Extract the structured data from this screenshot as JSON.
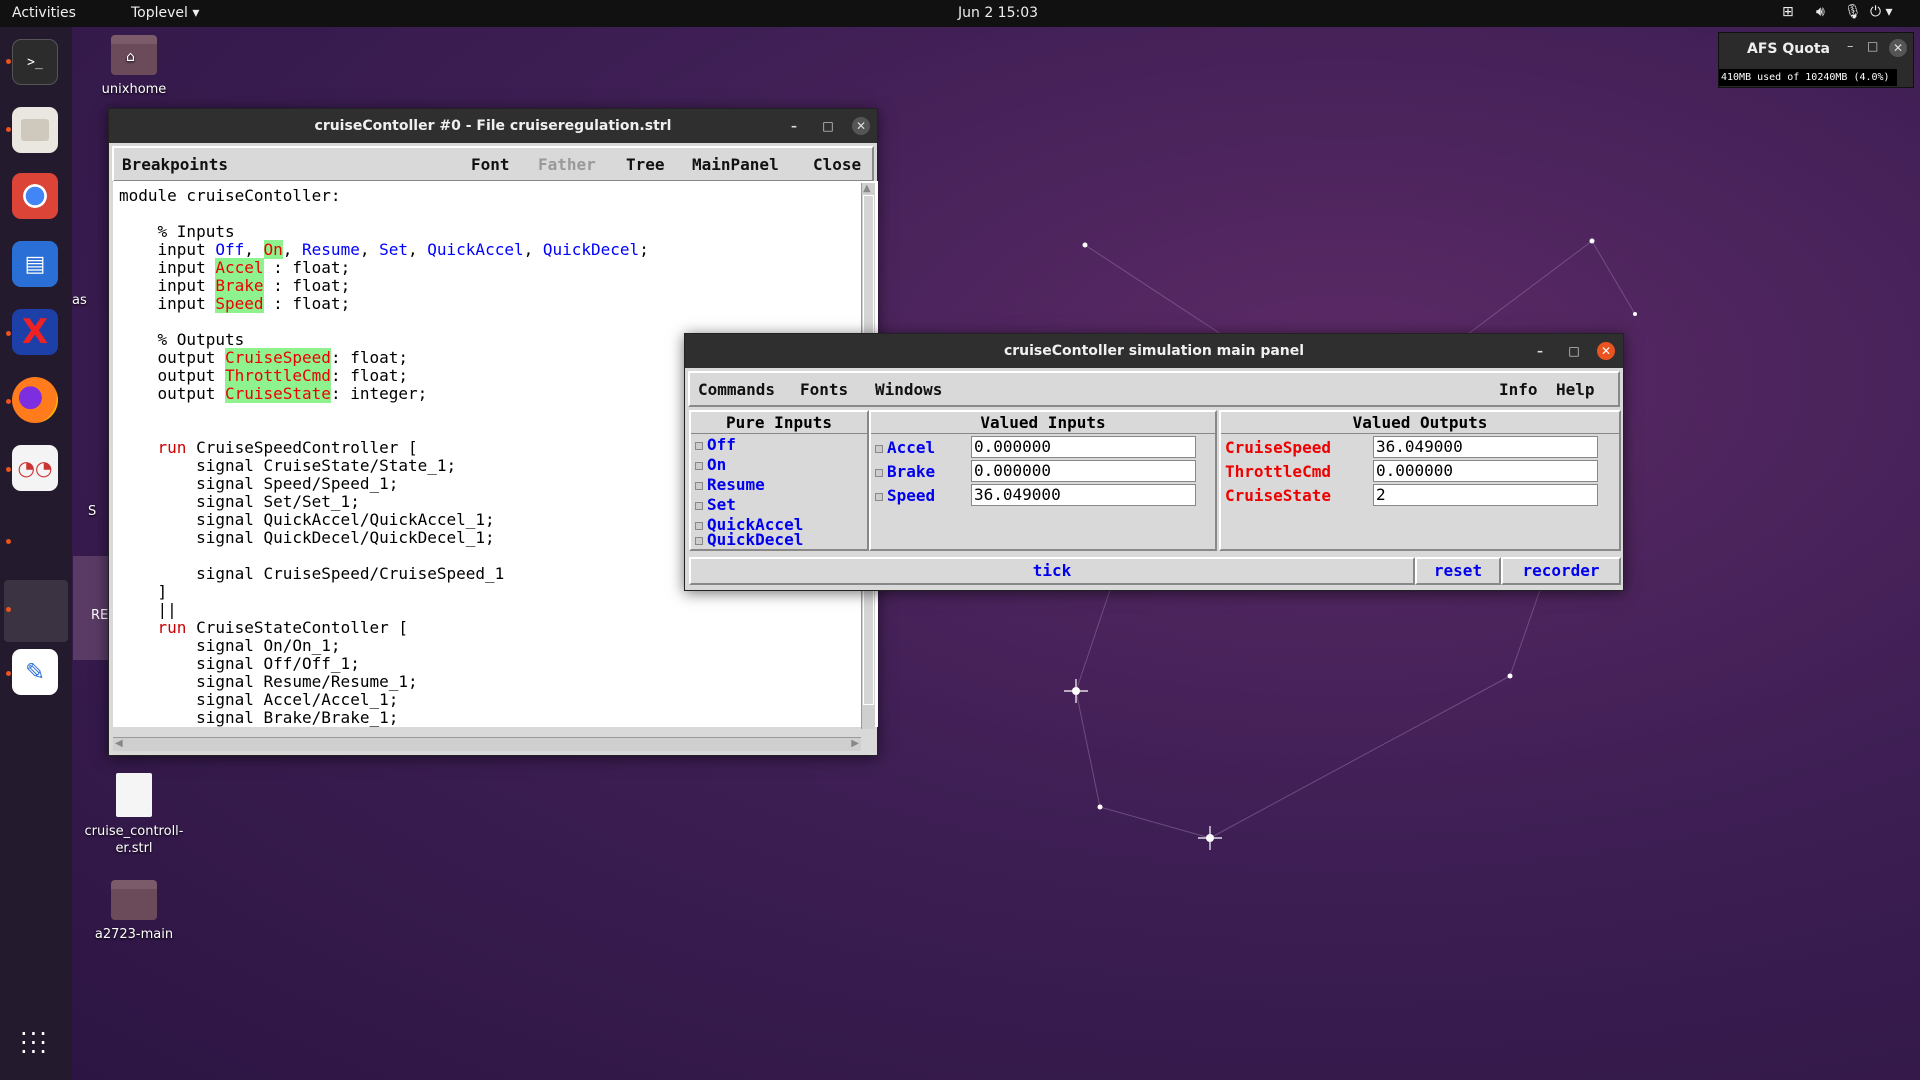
{
  "topbar": {
    "activities": "Activities",
    "app_menu": "Toplevel",
    "clock": "Jun 2  15:03"
  },
  "afs": {
    "title": "AFS Quota",
    "usage": "410MB used of 10240MB (4.0%)"
  },
  "desktop": {
    "items": [
      {
        "label": "unixhome"
      },
      {
        "label": "cruise_controll-er.strl"
      },
      {
        "label": "a2723-main"
      }
    ],
    "partial": [
      "as",
      "S",
      "RE"
    ]
  },
  "source_window": {
    "title": "cruiseContoller  #0 - File cruiseregulation.strl",
    "menu": {
      "breakpoints": "Breakpoints",
      "font": "Font",
      "father": "Father",
      "tree": "Tree",
      "mainpanel": "MainPanel",
      "close": "Close"
    }
  },
  "panel_window": {
    "title": "cruiseContoller simulation main panel",
    "menu": {
      "commands": "Commands",
      "fonts": "Fonts",
      "windows": "Windows",
      "info": "Info",
      "help": "Help"
    },
    "pure_inputs": {
      "header": "Pure Inputs",
      "items": [
        "Off",
        "On",
        "Resume",
        "Set",
        "QuickAccel",
        "QuickDecel"
      ]
    },
    "valued_inputs": {
      "header": "Valued Inputs",
      "rows": [
        {
          "name": "Accel",
          "value": "0.000000"
        },
        {
          "name": "Brake",
          "value": "0.000000"
        },
        {
          "name": "Speed",
          "value": "36.049000"
        }
      ]
    },
    "valued_outputs": {
      "header": "Valued Outputs",
      "rows": [
        {
          "name": "CruiseSpeed",
          "value": "36.049000"
        },
        {
          "name": "ThrottleCmd",
          "value": "0.000000"
        },
        {
          "name": "CruiseState",
          "value": "2"
        }
      ]
    },
    "buttons": {
      "tick": "tick",
      "reset": "reset",
      "recorder": "recorder"
    }
  },
  "colors": {
    "accent": "#e95420",
    "signal_blue": "#0000ee",
    "output_red": "#ee0000",
    "highlight_green": "#8ef28e"
  }
}
